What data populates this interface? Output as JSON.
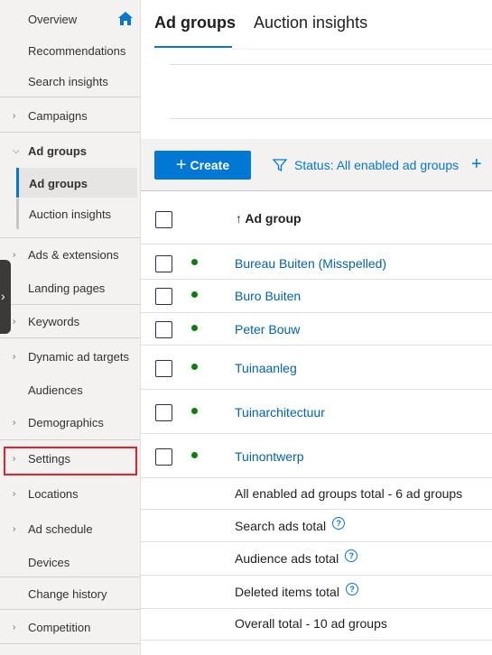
{
  "sidebar": {
    "items": [
      {
        "label": "Overview",
        "chevron": ""
      },
      {
        "label": "Recommendations",
        "chevron": ""
      },
      {
        "label": "Search insights",
        "chevron": ""
      },
      {
        "label": "Campaigns",
        "chevron": "right"
      },
      {
        "label": "Ad groups",
        "chevron": "down"
      },
      {
        "label": "Ad groups",
        "chevron": ""
      },
      {
        "label": "Auction insights",
        "chevron": ""
      },
      {
        "label": "Ads & extensions",
        "chevron": "right"
      },
      {
        "label": "Landing pages",
        "chevron": ""
      },
      {
        "label": "Keywords",
        "chevron": "right"
      },
      {
        "label": "Dynamic ad targets",
        "chevron": "right"
      },
      {
        "label": "Audiences",
        "chevron": ""
      },
      {
        "label": "Demographics",
        "chevron": "right"
      },
      {
        "label": "Settings",
        "chevron": "right"
      },
      {
        "label": "Locations",
        "chevron": "right"
      },
      {
        "label": "Ad schedule",
        "chevron": "right"
      },
      {
        "label": "Devices",
        "chevron": ""
      },
      {
        "label": "Change history",
        "chevron": ""
      },
      {
        "label": "Competition",
        "chevron": "right"
      }
    ],
    "home_icon": "home-icon",
    "highlighted_item": "Settings"
  },
  "tabs": [
    {
      "label": "Ad groups",
      "active": true
    },
    {
      "label": "Auction insights",
      "active": false
    }
  ],
  "toolbar": {
    "create_label": "Create",
    "filter_label": "Status: All enabled ad groups"
  },
  "table": {
    "header": "Ad group",
    "sort": "ascending",
    "rows": [
      {
        "name": "Bureau Buiten (Misspelled)",
        "status": "enabled"
      },
      {
        "name": "Buro Buiten",
        "status": "enabled"
      },
      {
        "name": "Peter Bouw",
        "status": "enabled"
      },
      {
        "name": "Tuinaanleg",
        "status": "enabled"
      },
      {
        "name": "Tuinarchitectuur",
        "status": "enabled"
      },
      {
        "name": "Tuinontwerp",
        "status": "enabled"
      }
    ],
    "totals": [
      {
        "label": "All enabled ad groups total - 6 ad groups",
        "help": false
      },
      {
        "label": "Search ads total",
        "help": true
      },
      {
        "label": "Audience ads total",
        "help": true
      },
      {
        "label": "Deleted items total",
        "help": true
      },
      {
        "label": "Overall total - 10 ad groups",
        "help": false
      }
    ]
  },
  "colors": {
    "accent": "#0078d4",
    "status_enabled": "#107c10",
    "highlight": "#e3212b"
  }
}
